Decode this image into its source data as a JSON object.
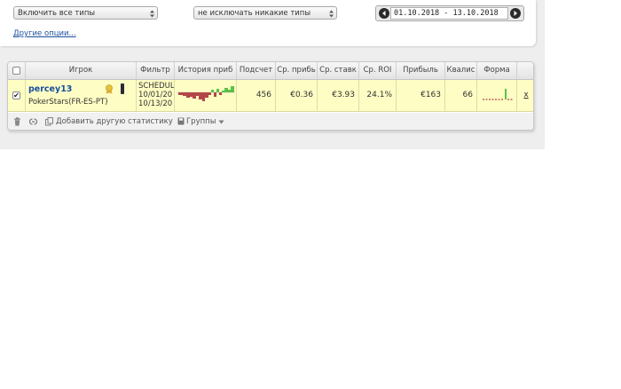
{
  "filters": {
    "include_select": "Включить все типы",
    "exclude_select": "не исключать никакие типы",
    "date_range": "01.10.2018 - 13.10.2018",
    "other_options_link": "Другие опции..."
  },
  "table": {
    "headers": [
      "Игрок",
      "Фильтр",
      "История приб",
      "Подсчет",
      "Ср. прибь",
      "Ср. ставк",
      "Ср. ROI",
      "Прибыль",
      "Квалис",
      "Форма"
    ],
    "row": {
      "checked": true,
      "player_name": "percey13",
      "player_site": "PokerStars(FR-ES-PT)",
      "filter_line1": "SCHEDUL",
      "filter_line2": "10/01/20",
      "filter_line3": "10/13/20",
      "count": "456",
      "avg_profit": "€0.36",
      "avg_stake": "€3.93",
      "avg_roi": "24.1%",
      "profit": "€163",
      "ability": "66",
      "remove": "x"
    }
  },
  "footer": {
    "add_stat": "Добавить другую статистику",
    "groups": "Группы"
  },
  "icons": [
    "trash-icon",
    "link-icon",
    "copy-icon",
    "save-icon",
    "dropdown-arrow-icon",
    "award-icon",
    "tag-icon",
    "prev-icon",
    "next-icon"
  ],
  "colors": {
    "selected_row": "#fdfdc4",
    "link": "#1a4f9c",
    "graph_positive": "#5cc04a",
    "graph_negative": "#b34747"
  }
}
